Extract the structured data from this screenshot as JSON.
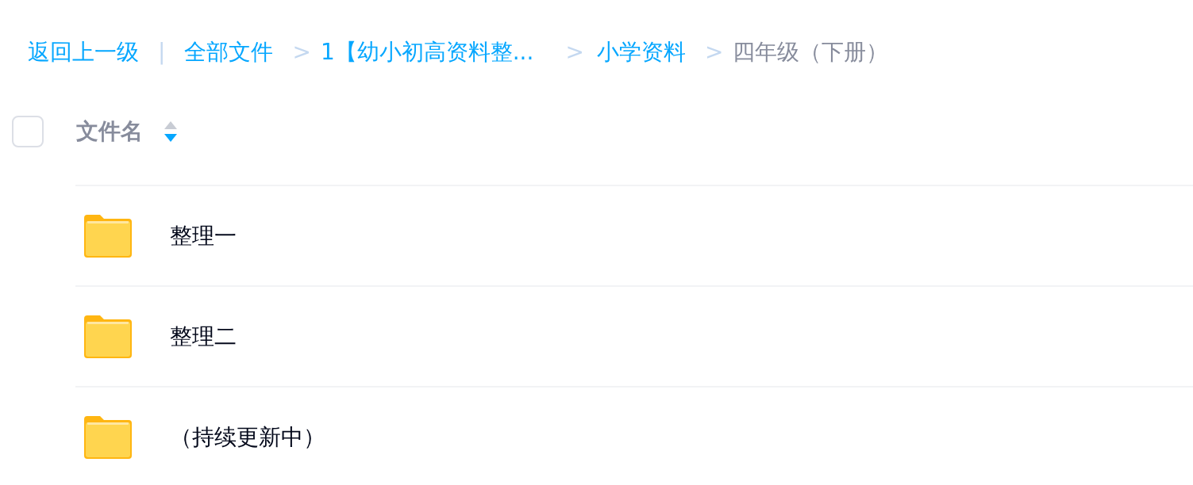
{
  "breadcrumb": [
    {
      "kind": "link",
      "text": "返回上一级"
    },
    {
      "kind": "divider",
      "text": "|"
    },
    {
      "kind": "link",
      "text": "全部文件"
    },
    {
      "kind": "separator",
      "text": ">"
    },
    {
      "kind": "link",
      "text": "1【幼小初高资料整..."
    },
    {
      "kind": "separator",
      "text": ">"
    },
    {
      "kind": "link",
      "text": "小学资料"
    },
    {
      "kind": "separator",
      "text": ">"
    },
    {
      "kind": "current",
      "text": "四年级（下册）"
    }
  ],
  "header": {
    "select_all_checked": false,
    "column": "文件名",
    "sorted_descending": true
  },
  "rows": [
    {
      "name": "整理一"
    },
    {
      "name": "整理二"
    },
    {
      "name": "（持续更新中）"
    }
  ]
}
